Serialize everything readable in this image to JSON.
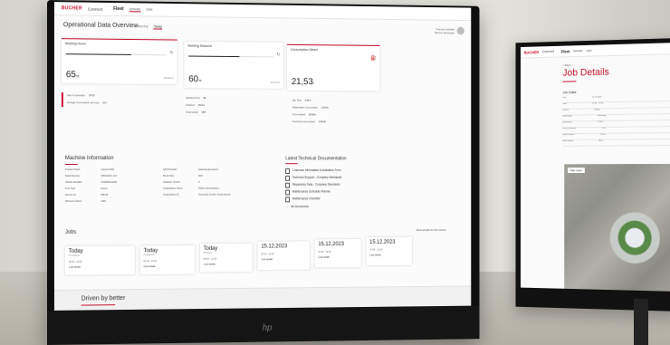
{
  "main": {
    "brand": "BUCHER",
    "app": "Connect",
    "nav": {
      "fleet": "Fleet",
      "links": [
        "Vehicles",
        "Jobs"
      ]
    },
    "page_title": "Operational Data Overview",
    "tabs": [
      "Yesterday",
      "Today"
    ],
    "user": "Francis Schöffel",
    "user_sub": "Bucher Municipal",
    "cards": [
      {
        "title": "Working Hours",
        "value": "65",
        "unit": "%",
        "ref": "100 Hours",
        "fill": 0.65
      },
      {
        "title": "Working Distance",
        "value": "60",
        "unit": "%",
        "ref": "100 Hours",
        "fill": 0.6
      },
      {
        "title": "Consumption Diesel",
        "value": "21,53",
        "unit": "l"
      }
    ],
    "kv": [
      {
        "label": "Start of Operation",
        "value": "07:00"
      },
      {
        "label": "Working Time",
        "value": "8h"
      },
      {
        "label": "Idle Time",
        "value": "0:09 h"
      },
      {
        "label": "Average Consumption per hour",
        "value": "3,6 l"
      },
      {
        "label": "Distance",
        "value": "54 km"
      },
      {
        "label": "Wastewater Consumption",
        "value": "0:09 l/h"
      },
      {
        "label": "Road speed",
        "value": "28 h"
      },
      {
        "label": "Time tracked",
        "value": "00:00 h"
      },
      {
        "label": "Fuel level consumption",
        "value": "0:00 l/h"
      }
    ],
    "machine_title": "Machine Information",
    "machine": [
      {
        "label": "Product Model",
        "value": "CityCat 2020"
      },
      {
        "label": "Serial Number",
        "value": "NRW-MAC-124"
      },
      {
        "label": "Vehicle Identifier",
        "value": "VIN08M120006"
      },
      {
        "label": "Fuel Type",
        "value": "Diesel"
      },
      {
        "label": "Service ID",
        "value": "888-05"
      },
      {
        "label": "Warranty Status",
        "value": "Valid"
      }
    ],
    "machine2": [
      {
        "label": "GPS Provider",
        "value": "NetCaseOperations"
      },
      {
        "label": "Brush Size",
        "value": "60%"
      },
      {
        "label": "Software Version",
        "value": "8"
      },
      {
        "label": "Organisation Name",
        "value": "Public Administration"
      },
      {
        "label": "Organisation ID",
        "value": "Gemeinde GmbH, Duivendrecht"
      }
    ],
    "docs_title": "Latest Technical Documentation",
    "docs": [
      "Customer Information & Activation Form",
      "Technical Support - Company Standards",
      "Reparatory Data - Company Standards",
      "Maintenance Schedule Planner",
      "Maintenance Checklist"
    ],
    "docs_more": "All Documents",
    "jobs_title": "Jobs",
    "show_all": "Show all jobs for this vehicle",
    "jobs": [
      {
        "date": "Today",
        "sub": "In progress",
        "time": "06:00 - 12:00",
        "meta": "1 job details"
      },
      {
        "date": "Today",
        "sub": "Completed",
        "time": "06:00 - 12:00",
        "meta": "2 job details"
      },
      {
        "date": "Today",
        "sub": "Planned",
        "time": "06:00 - 12:00",
        "meta": "1 job details"
      },
      {
        "date": "15.12.2023",
        "sub": "",
        "time": "07:00 - 12:00",
        "meta": "1 job details"
      },
      {
        "date": "15.12.2023",
        "sub": "",
        "time": "07:00 - 12:00",
        "meta": "1 job details"
      },
      {
        "date": "15.12.2023",
        "sub": "",
        "time": "07:00 - 12:00",
        "meta": "1 job details"
      }
    ],
    "footer": "Driven by better",
    "hp": "hp"
  },
  "secondary": {
    "brand": "BUCHER",
    "app": "Connect",
    "fleet": "Fleet",
    "links": [
      "Vehicles",
      "Jobs"
    ],
    "back": "< Back",
    "title": "Job Details",
    "job_data": "Job Data",
    "rows": [
      {
        "label": "Date",
        "value": "15.12.2023"
      },
      {
        "label": "Time",
        "value": "07:00 - 12:00"
      },
      {
        "label": "Vehicle",
        "value": "CityCat"
      },
      {
        "label": "Work Mode",
        "value": "Sweeping"
      },
      {
        "label": "Work Hours",
        "value": "4:30 h"
      },
      {
        "label": "Fuel Consumed",
        "value": "12,4 l"
      },
      {
        "label": "Work Distance",
        "value": "22 km"
      },
      {
        "label": "Brush Speed",
        "value": "Auto"
      }
    ],
    "map_label": "Map Layer"
  }
}
